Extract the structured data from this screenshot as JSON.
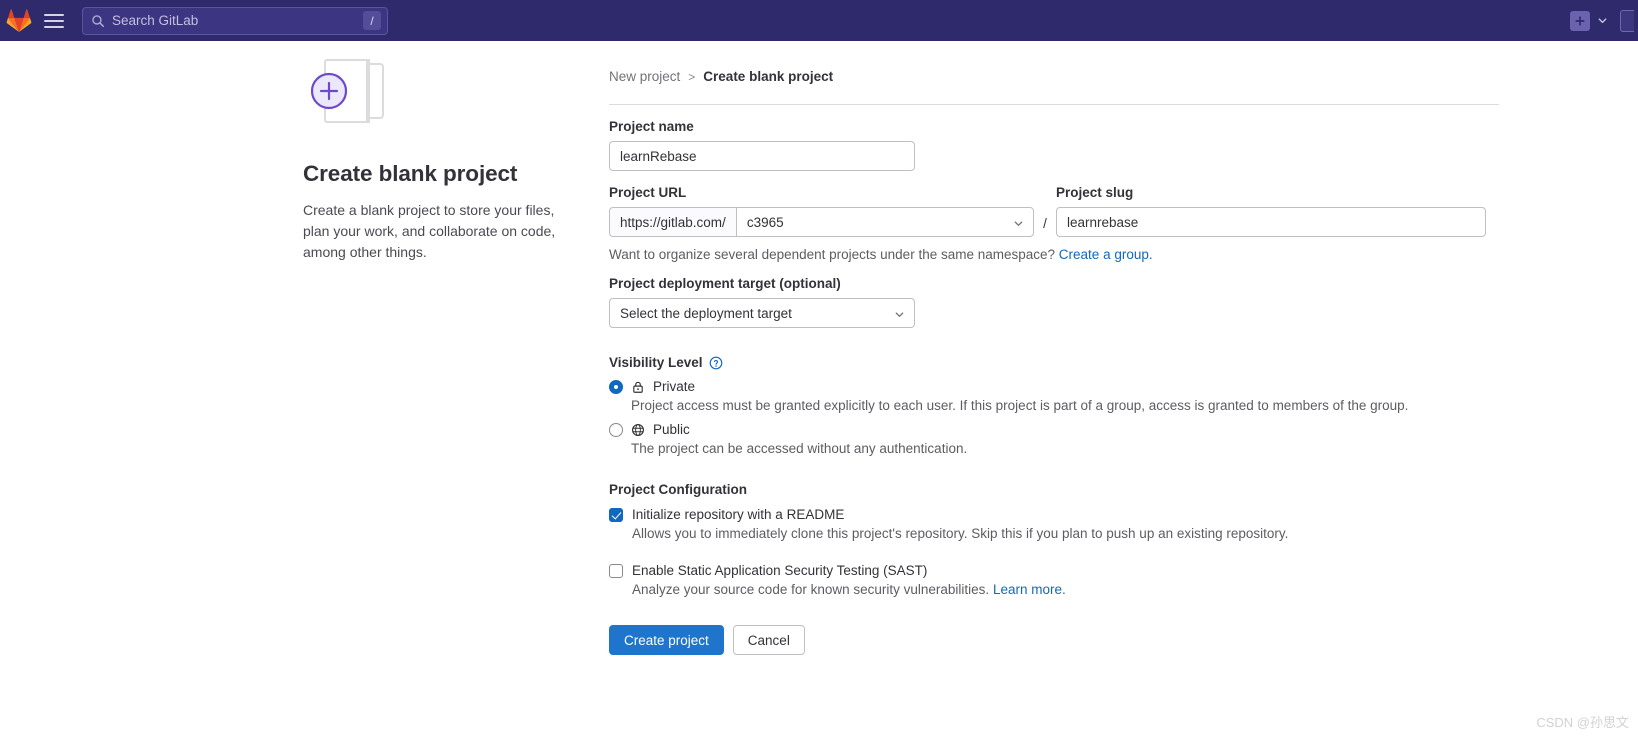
{
  "topbar": {
    "logo_name": "gitlab-logo",
    "menu_label": "hamburger-menu",
    "search": {
      "placeholder": "Search GitLab",
      "shortcut_key": "/"
    },
    "new_button_label": "+",
    "brand_color": "#2f2a6b"
  },
  "hero": {
    "title": "Create blank project",
    "description": "Create a blank project to store your files, plan your work, and collaborate on code, among other things."
  },
  "breadcrumb": {
    "parent": "New project",
    "separator": ">",
    "current": "Create blank project"
  },
  "form": {
    "project_name": {
      "label": "Project name",
      "value": "learnRebase"
    },
    "project_url": {
      "label": "Project URL",
      "prefix": "https://gitlab.com/",
      "namespace": "c3965",
      "separator": "/"
    },
    "project_slug": {
      "label": "Project slug",
      "value": "learnrebase"
    },
    "namespace_helper": {
      "text": "Want to organize several dependent projects under the same namespace?",
      "link": "Create a group.",
      "link_color": "#1068bf"
    },
    "deployment_target": {
      "label": "Project deployment target (optional)",
      "value": "Select the deployment target"
    },
    "visibility": {
      "heading": "Visibility Level",
      "help_icon": "question-circle-icon",
      "options": [
        {
          "label": "Private",
          "icon": "lock-icon",
          "selected": true,
          "description": "Project access must be granted explicitly to each user. If this project is part of a group, access is granted to members of the group."
        },
        {
          "label": "Public",
          "icon": "globe-icon",
          "selected": false,
          "description": "The project can be accessed without any authentication."
        }
      ]
    },
    "configuration": {
      "heading": "Project Configuration",
      "items": [
        {
          "label": "Initialize repository with a README",
          "checked": true,
          "description": "Allows you to immediately clone this project's repository. Skip this if you plan to push up an existing repository.",
          "link": ""
        },
        {
          "label": "Enable Static Application Security Testing (SAST)",
          "checked": false,
          "description": "Analyze your source code for known security vulnerabilities.",
          "link": "Learn more."
        }
      ]
    },
    "actions": {
      "submit": "Create project",
      "cancel": "Cancel",
      "submit_color": "#1f75cb"
    }
  },
  "watermark": "CSDN @孙思文"
}
